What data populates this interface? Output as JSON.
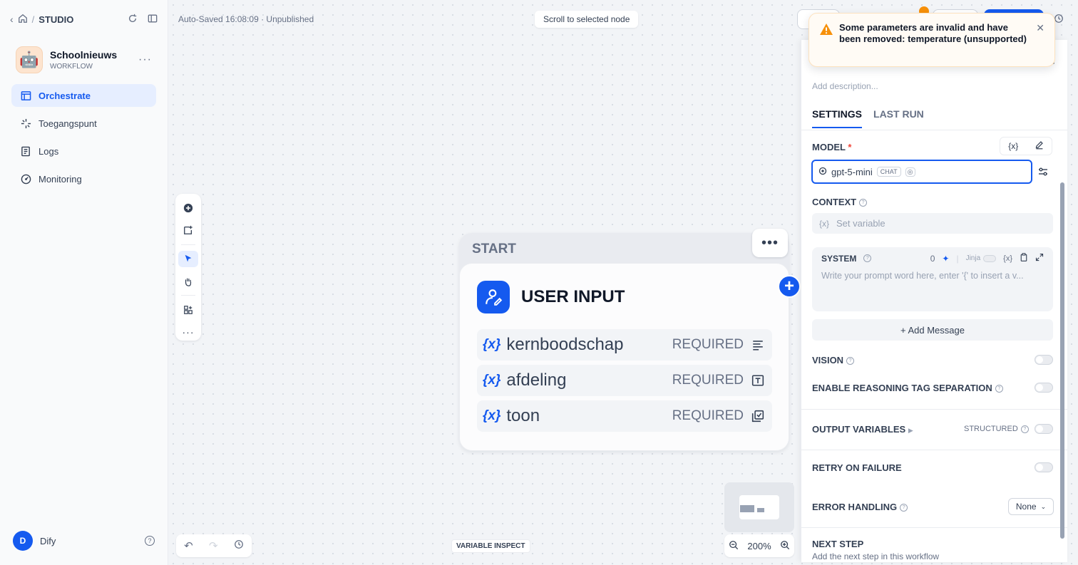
{
  "sidebar": {
    "studio_label": "STUDIO",
    "app": {
      "name": "Schoolnieuws",
      "type": "WORKFLOW",
      "emoji": "🤖"
    },
    "nav": [
      {
        "label": "Orchestrate",
        "icon": "layout-icon",
        "active": true
      },
      {
        "label": "Toegangspunt",
        "icon": "access-point-icon",
        "active": false
      },
      {
        "label": "Logs",
        "icon": "logs-icon",
        "active": false
      },
      {
        "label": "Monitoring",
        "icon": "monitoring-icon",
        "active": false
      }
    ],
    "user": {
      "initial": "D",
      "name": "Dify"
    }
  },
  "canvas": {
    "autosave": "Auto-Saved 16:08:09 · Unpublished",
    "scroll_button": "Scroll to selected node",
    "zoom": "200%",
    "variable_inspect": "VARIABLE INSPECT"
  },
  "node": {
    "label": "START",
    "title": "USER INPUT",
    "variables": [
      {
        "name": "kernboodschap",
        "required": "REQUIRED",
        "icon": "paragraph-icon"
      },
      {
        "name": "afdeling",
        "required": "REQUIRED",
        "icon": "text-input-icon"
      },
      {
        "name": "toon",
        "required": "REQUIRED",
        "icon": "select-icon"
      }
    ]
  },
  "toast": {
    "message": "Some parameters are invalid and have been removed: temperature (unsupported)"
  },
  "panel": {
    "description_placeholder": "Add description...",
    "tabs": [
      {
        "label": "SETTINGS",
        "active": true
      },
      {
        "label": "LAST RUN",
        "active": false
      }
    ],
    "model_label": "MODEL",
    "model_name": "gpt-5-mini",
    "model_badge": "CHAT",
    "context_label": "CONTEXT",
    "context_placeholder": "Set variable",
    "system_label": "SYSTEM",
    "system_count": "0",
    "system_jinja": "Jinja",
    "system_placeholder": "Write your prompt word here, enter '{' to insert a v...",
    "add_message": "+ Add Message",
    "vision_label": "VISION",
    "reasoning_label": "ENABLE REASONING TAG SEPARATION",
    "output_label": "OUTPUT VARIABLES",
    "structured_label": "STRUCTURED",
    "retry_label": "RETRY ON FAILURE",
    "error_label": "ERROR HANDLING",
    "error_value": "None",
    "next_step_label": "NEXT STEP",
    "next_step_desc": "Add the next step in this workflow"
  },
  "colors": {
    "accent": "#155aef",
    "warning": "#f79009",
    "required": "#f04438"
  }
}
